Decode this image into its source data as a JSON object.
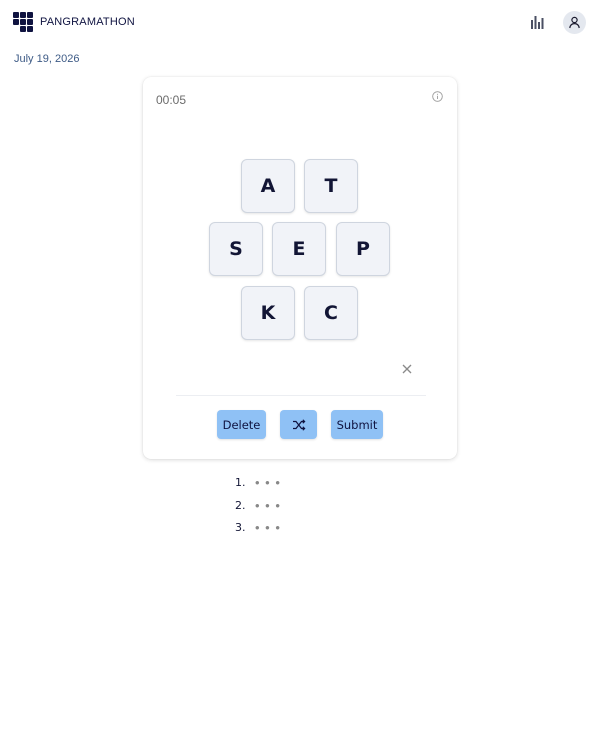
{
  "header": {
    "app_title": "PANGRAMATHON",
    "logo_icon": "grid-logo-icon",
    "stats_icon": "bar-chart-icon",
    "profile_icon": "user-icon"
  },
  "date": "July 19, 2026",
  "game": {
    "timer": "00:05",
    "info_icon": "info-icon",
    "letters": {
      "top_left": "A",
      "top_right": "T",
      "mid_left": "S",
      "center": "E",
      "mid_right": "P",
      "bottom_left": "K",
      "bottom_right": "C"
    },
    "clear_icon": "close-icon",
    "buttons": {
      "delete_label": "Delete",
      "shuffle_icon": "shuffle-icon",
      "submit_label": "Submit"
    }
  },
  "answers": [
    {
      "number": "1.",
      "value": "• • •"
    },
    {
      "number": "2.",
      "value": "• • •"
    },
    {
      "number": "3.",
      "value": "• • •"
    }
  ],
  "colors": {
    "accent_button": "#8fc1f5",
    "brand_navy": "#0f1340",
    "date_text": "#3e5b86",
    "tile_bg": "#f1f3f8"
  }
}
